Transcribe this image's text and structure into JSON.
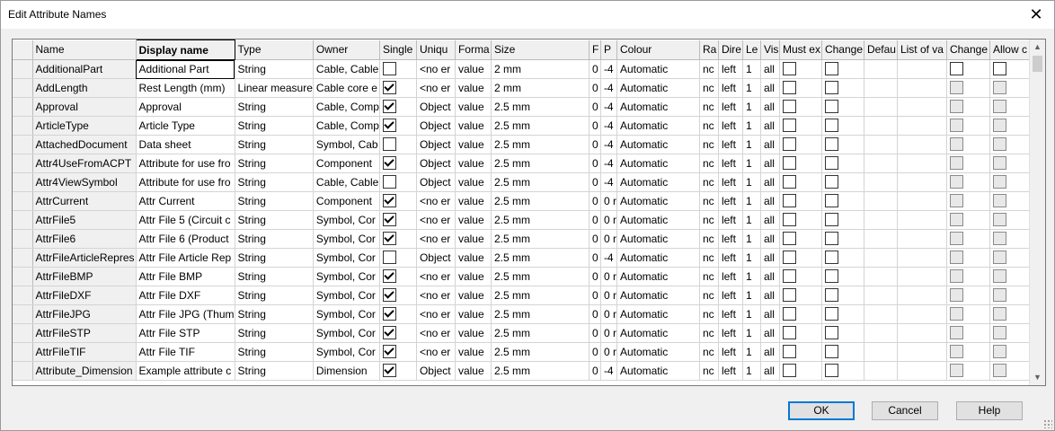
{
  "window": {
    "title": "Edit Attribute Names",
    "close_glyph": "✕"
  },
  "columns": [
    "Name",
    "Display name",
    "Type",
    "Owner",
    "Single",
    "Uniqu",
    "Forma",
    "Size",
    "F",
    "P",
    "Colour",
    "Ra",
    "Dire",
    "Le",
    "Vis",
    "Must ex",
    "Change",
    "Defau",
    "List of va",
    "Change",
    "Allow c"
  ],
  "rows": [
    {
      "name": "AdditionalPart",
      "display": "Additional Part",
      "type": "String",
      "owner": "Cable, Cable",
      "single": false,
      "unique": "<no er",
      "format": "value",
      "size": "2 mm",
      "f": "0",
      "p": "-4",
      "colour": "Automatic",
      "ra": "nc",
      "dir": "left",
      "le": "1",
      "vis": "all"
    },
    {
      "name": "AddLength",
      "display": "Rest Length (mm)",
      "type": "Linear measure",
      "owner": "Cable core e",
      "single": true,
      "unique": "<no er",
      "format": "value",
      "size": "2 mm",
      "f": "0",
      "p": "-4",
      "colour": "Automatic",
      "ra": "nc",
      "dir": "left",
      "le": "1",
      "vis": "all"
    },
    {
      "name": "Approval",
      "display": "Approval",
      "type": "String",
      "owner": "Cable, Comp",
      "single": true,
      "unique": "Object",
      "format": "value",
      "size": "2.5 mm",
      "f": "0",
      "p": "-4",
      "colour": "Automatic",
      "ra": "nc",
      "dir": "left",
      "le": "1",
      "vis": "all"
    },
    {
      "name": "ArticleType",
      "display": "Article Type",
      "type": "String",
      "owner": "Cable, Comp",
      "single": true,
      "unique": "Object",
      "format": "value",
      "size": "2.5 mm",
      "f": "0",
      "p": "-4",
      "colour": "Automatic",
      "ra": "nc",
      "dir": "left",
      "le": "1",
      "vis": "all"
    },
    {
      "name": "AttachedDocument",
      "display": "Data sheet",
      "type": "String",
      "owner": "Symbol, Cab",
      "single": false,
      "unique": "Object",
      "format": "value",
      "size": "2.5 mm",
      "f": "0",
      "p": "-4",
      "colour": "Automatic",
      "ra": "nc",
      "dir": "left",
      "le": "1",
      "vis": "all"
    },
    {
      "name": "Attr4UseFromACPT",
      "display": "Attribute for use fro",
      "type": "String",
      "owner": "Component",
      "single": true,
      "unique": "Object",
      "format": "value",
      "size": "2.5 mm",
      "f": "0",
      "p": "-4",
      "colour": "Automatic",
      "ra": "nc",
      "dir": "left",
      "le": "1",
      "vis": "all"
    },
    {
      "name": "Attr4ViewSymbol",
      "display": "Attribute for use fro",
      "type": "String",
      "owner": "Cable, Cable",
      "single": false,
      "unique": "Object",
      "format": "value",
      "size": "2.5 mm",
      "f": "0",
      "p": "-4",
      "colour": "Automatic",
      "ra": "nc",
      "dir": "left",
      "le": "1",
      "vis": "all"
    },
    {
      "name": "AttrCurrent",
      "display": "Attr Current",
      "type": "String",
      "owner": "Component",
      "single": true,
      "unique": "<no er",
      "format": "value",
      "size": "2.5 mm",
      "f": "0",
      "p": "0 r",
      "colour": "Automatic",
      "ra": "nc",
      "dir": "left",
      "le": "1",
      "vis": "all"
    },
    {
      "name": "AttrFile5",
      "display": "Attr File 5 (Circuit c",
      "type": "String",
      "owner": "Symbol, Cor",
      "single": true,
      "unique": "<no er",
      "format": "value",
      "size": "2.5 mm",
      "f": "0",
      "p": "0 r",
      "colour": "Automatic",
      "ra": "nc",
      "dir": "left",
      "le": "1",
      "vis": "all"
    },
    {
      "name": "AttrFile6",
      "display": "Attr File 6 (Product",
      "type": "String",
      "owner": "Symbol, Cor",
      "single": true,
      "unique": "<no er",
      "format": "value",
      "size": "2.5 mm",
      "f": "0",
      "p": "0 r",
      "colour": "Automatic",
      "ra": "nc",
      "dir": "left",
      "le": "1",
      "vis": "all"
    },
    {
      "name": "AttrFileArticleRepres",
      "display": "Attr File Article Rep",
      "type": "String",
      "owner": "Symbol, Cor",
      "single": false,
      "unique": "Object",
      "format": "value",
      "size": "2.5 mm",
      "f": "0",
      "p": "-4",
      "colour": "Automatic",
      "ra": "nc",
      "dir": "left",
      "le": "1",
      "vis": "all"
    },
    {
      "name": "AttrFileBMP",
      "display": "Attr File BMP",
      "type": "String",
      "owner": "Symbol, Cor",
      "single": true,
      "unique": "<no er",
      "format": "value",
      "size": "2.5 mm",
      "f": "0",
      "p": "0 r",
      "colour": "Automatic",
      "ra": "nc",
      "dir": "left",
      "le": "1",
      "vis": "all"
    },
    {
      "name": "AttrFileDXF",
      "display": "Attr File DXF",
      "type": "String",
      "owner": "Symbol, Cor",
      "single": true,
      "unique": "<no er",
      "format": "value",
      "size": "2.5 mm",
      "f": "0",
      "p": "0 r",
      "colour": "Automatic",
      "ra": "nc",
      "dir": "left",
      "le": "1",
      "vis": "all"
    },
    {
      "name": "AttrFileJPG",
      "display": "Attr File JPG (Thum",
      "type": "String",
      "owner": "Symbol, Cor",
      "single": true,
      "unique": "<no er",
      "format": "value",
      "size": "2.5 mm",
      "f": "0",
      "p": "0 r",
      "colour": "Automatic",
      "ra": "nc",
      "dir": "left",
      "le": "1",
      "vis": "all"
    },
    {
      "name": "AttrFileSTP",
      "display": "Attr File STP",
      "type": "String",
      "owner": "Symbol, Cor",
      "single": true,
      "unique": "<no er",
      "format": "value",
      "size": "2.5 mm",
      "f": "0",
      "p": "0 r",
      "colour": "Automatic",
      "ra": "nc",
      "dir": "left",
      "le": "1",
      "vis": "all"
    },
    {
      "name": "AttrFileTIF",
      "display": "Attr File TIF",
      "type": "String",
      "owner": "Symbol, Cor",
      "single": true,
      "unique": "<no er",
      "format": "value",
      "size": "2.5 mm",
      "f": "0",
      "p": "0 r",
      "colour": "Automatic",
      "ra": "nc",
      "dir": "left",
      "le": "1",
      "vis": "all"
    },
    {
      "name": "Attribute_Dimension",
      "display": "Example attribute c",
      "type": "String",
      "owner": "Dimension",
      "single": true,
      "unique": "Object",
      "format": "value",
      "size": "2.5 mm",
      "f": "0",
      "p": "-4",
      "colour": "Automatic",
      "ra": "nc",
      "dir": "left",
      "le": "1",
      "vis": "all"
    }
  ],
  "grey_change_rows": [
    1,
    2,
    3,
    4,
    5,
    6,
    7,
    8,
    9,
    10,
    11,
    12,
    13,
    14,
    15,
    16
  ],
  "buttons": {
    "ok": "OK",
    "cancel": "Cancel",
    "help": "Help"
  },
  "scroll": {
    "up_glyph": "▲",
    "down_glyph": "▼"
  }
}
